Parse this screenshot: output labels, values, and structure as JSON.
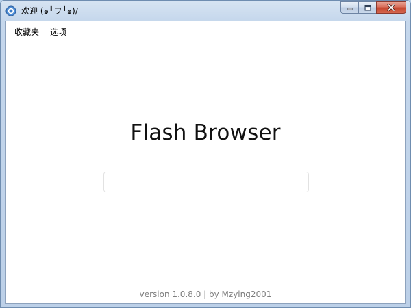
{
  "window": {
    "title": "欢迎 (๑╹ワ╹๑)/",
    "controls": {
      "minimize_icon": "minimize-icon",
      "maximize_icon": "maximize-icon",
      "close_icon": "close-icon"
    }
  },
  "menubar": {
    "items": [
      {
        "label": "收藏夹"
      },
      {
        "label": "选项"
      }
    ]
  },
  "main": {
    "title": "Flash Browser",
    "address_input": {
      "value": "",
      "placeholder": ""
    }
  },
  "footer": {
    "text": "version 1.0.8.0 | by Mzying2001"
  },
  "colors": {
    "close_button": "#c4452e",
    "window_frame": "#bcd0e8",
    "footer_text": "#7d7d7d"
  }
}
